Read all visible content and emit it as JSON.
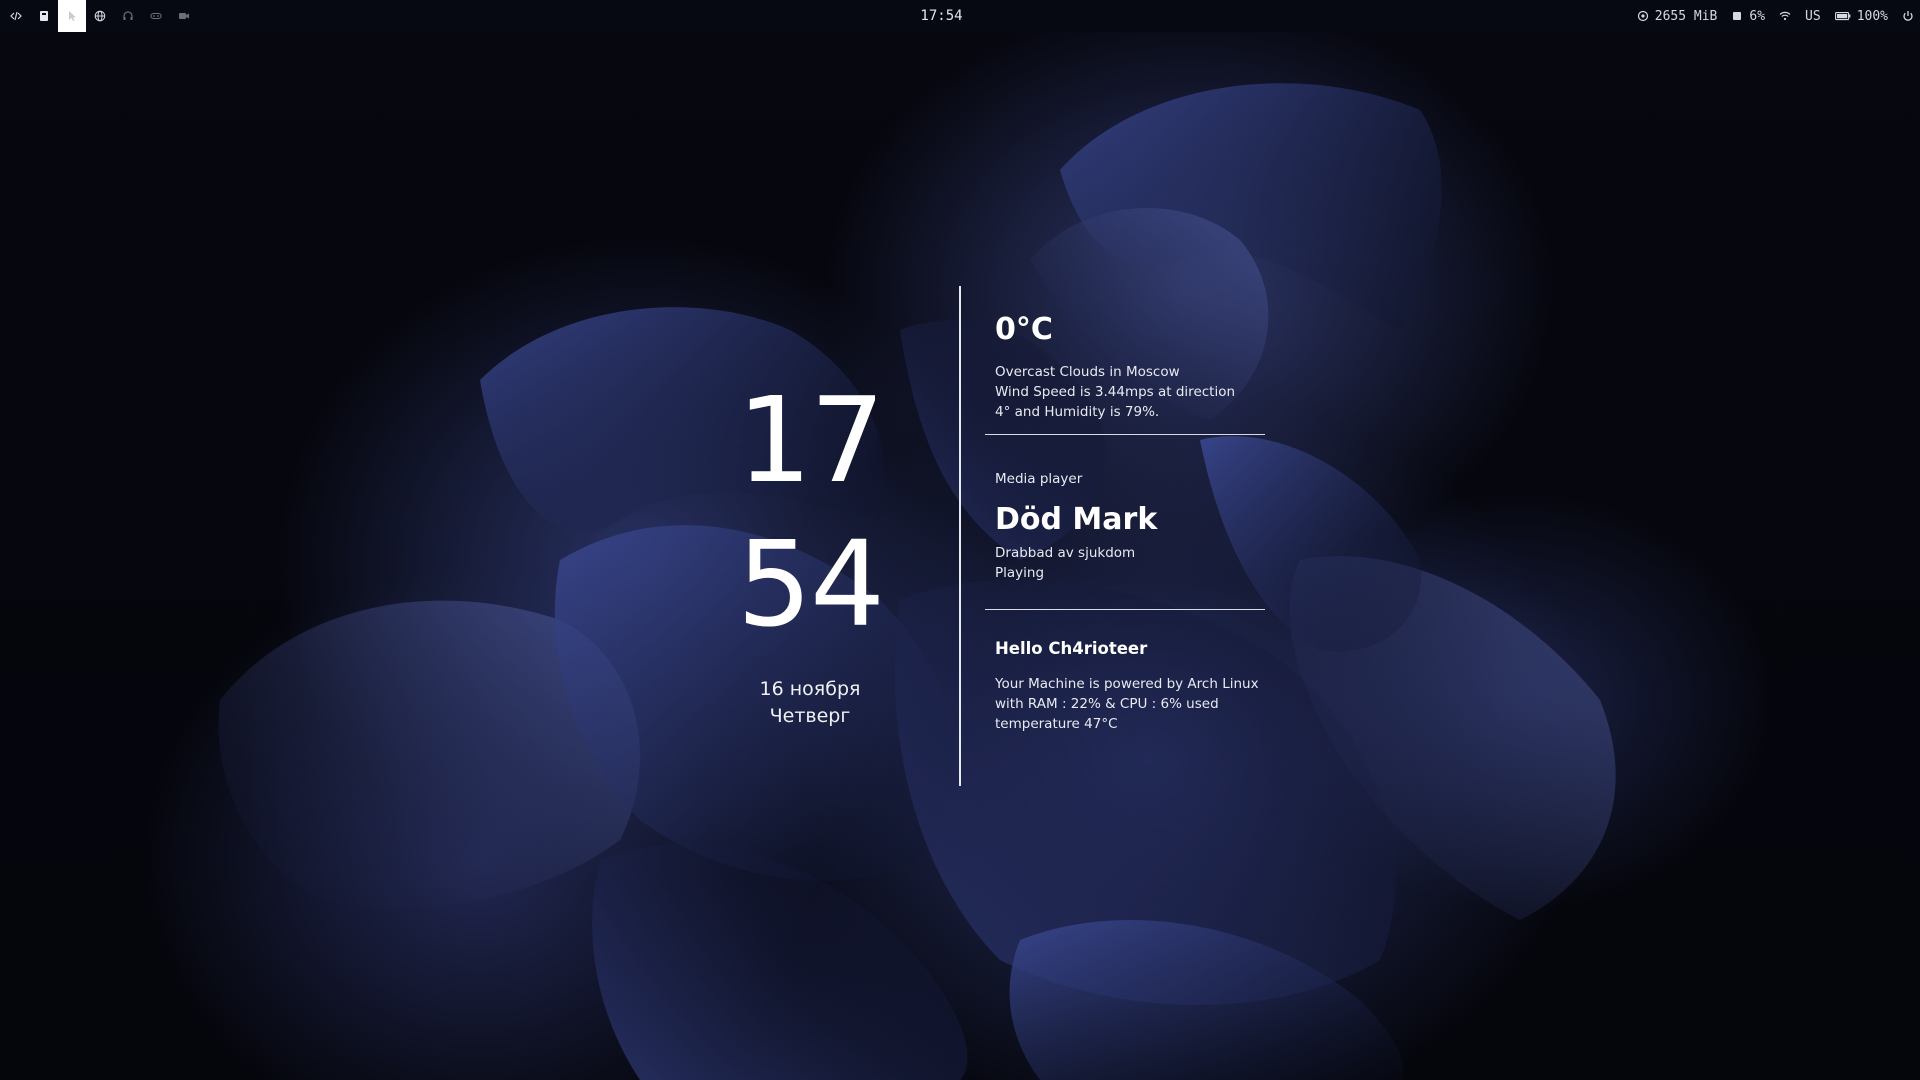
{
  "topbar": {
    "workspaces": [
      {
        "icon": "code-icon",
        "active": false
      },
      {
        "icon": "terminal-icon",
        "active": false
      },
      {
        "icon": "cursor-icon",
        "active": true
      },
      {
        "icon": "globe-icon",
        "active": false
      },
      {
        "icon": "headphones-icon",
        "active": false
      },
      {
        "icon": "gamepad-icon",
        "active": false
      },
      {
        "icon": "video-icon",
        "active": false
      }
    ],
    "clock": "17:54",
    "tray": {
      "memory": "2655 MiB",
      "cpu": "6%",
      "keyboard_layout": "US",
      "battery": "100%"
    }
  },
  "clock_widget": {
    "hour": "17",
    "minute": "54",
    "date": "16 ноября",
    "weekday": "Четверг"
  },
  "weather": {
    "temperature": "0°C",
    "lines": [
      "Overcast Clouds in Moscow",
      "Wind Speed is 3.44mps at direction",
      "4° and Humidity is 79%."
    ]
  },
  "media": {
    "label": "Media player",
    "title": "Död Mark",
    "album": "Drabbad av sjukdom",
    "status": "Playing"
  },
  "system": {
    "greeting": "Hello Ch4rioteer",
    "lines": [
      "Your Machine is powered by Arch Linux",
      "with RAM : 22% & CPU : 6% used",
      "temperature 47°C"
    ]
  },
  "colors": {
    "bar_background": "#070912",
    "accent_text": "#ffffff",
    "wallpaper_blue": "#2f3a78"
  }
}
